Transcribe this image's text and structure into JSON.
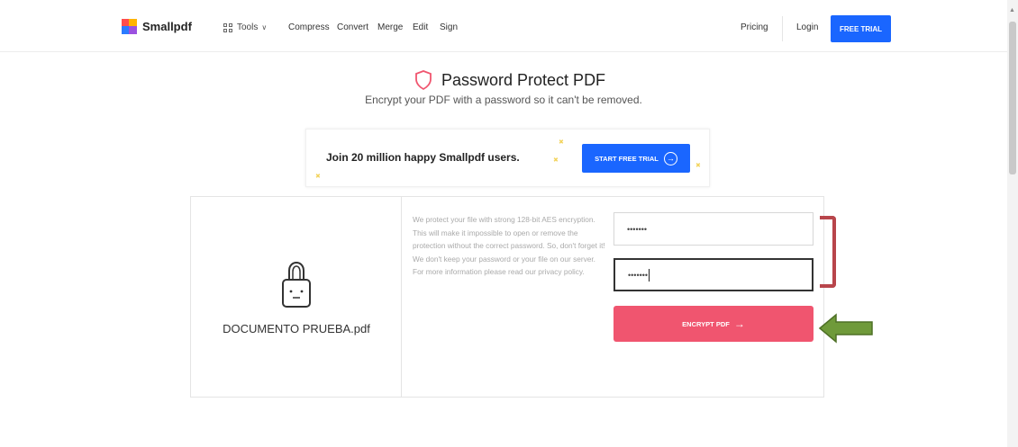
{
  "nav": {
    "logo_text": "Smallpdf",
    "tools_label": "Tools",
    "links": [
      "Compress",
      "Convert",
      "Merge",
      "Edit",
      "Sign"
    ],
    "pricing": "Pricing",
    "login": "Login",
    "free_trial": "FREE TRIAL"
  },
  "header": {
    "title": "Password Protect PDF",
    "subtitle": "Encrypt your PDF with a password so it can't be removed."
  },
  "promo": {
    "text": "Join 20 million happy Smallpdf users.",
    "button": "START FREE TRIAL"
  },
  "file": {
    "name": "DOCUMENTO PRUEBA.pdf"
  },
  "info": {
    "line1": "We protect your file with strong 128-bit AES encryption. This will make it impossible to open or remove the protection without the correct password. So, don't forget it!",
    "line2": "We don't keep your password or your file on our server. For more information please read our privacy policy."
  },
  "form": {
    "password_value": "•••••••",
    "confirm_value": "•••••••",
    "encrypt_button": "ENCRYPT PDF"
  },
  "colors": {
    "brand_blue": "#1a66ff",
    "encrypt_pink": "#f0556f",
    "annotation_red": "#b8454b",
    "annotation_green": "#6f9a3a"
  }
}
